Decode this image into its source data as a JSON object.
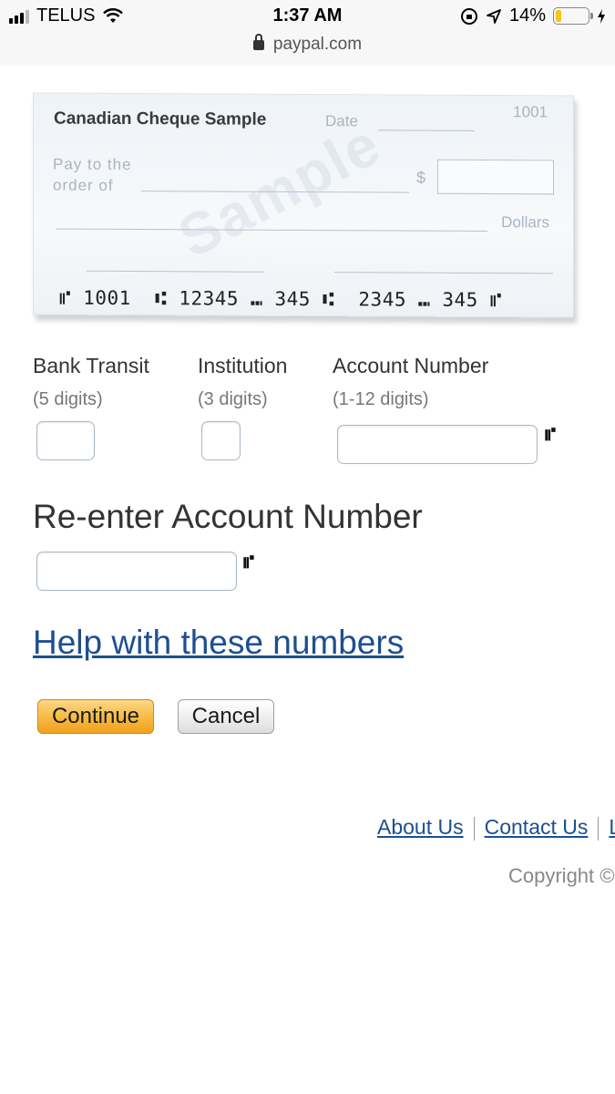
{
  "status_bar": {
    "carrier": "TELUS",
    "time": "1:37 AM",
    "battery": "14%",
    "battery_level": 0.14
  },
  "browser": {
    "url": "paypal.com"
  },
  "cheque": {
    "title": "Canadian Cheque Sample",
    "date_label": "Date",
    "cheque_number": "1001",
    "pay_to_line1": "Pay to the",
    "pay_to_line2": "order of",
    "dollar_sign": "$",
    "dollars_label": "Dollars",
    "watermark": "Sample",
    "micr_line": "⑈ 1001  ⑆ 12345 ⑉ 345 ⑆  2345 ⑉ 345 ⑈"
  },
  "form": {
    "bank_transit": {
      "label": "Bank Transit",
      "hint": "(5 digits)",
      "value": ""
    },
    "institution": {
      "label": "Institution",
      "hint": "(3 digits)",
      "value": ""
    },
    "account_number": {
      "label": "Account Number",
      "hint": "(1-12 digits)",
      "value": ""
    },
    "reenter_account": {
      "label": "Re-enter Account Number",
      "value": ""
    },
    "micr_symbol": "⑈",
    "help_link": "Help with these numbers",
    "continue_label": "Continue",
    "cancel_label": "Cancel"
  },
  "footer": {
    "links": [
      "About Us",
      "Contact Us",
      "L"
    ],
    "copyright": "Copyright ©"
  },
  "colors": {
    "link": "#1c4f91",
    "continue_button": "#f7b940"
  }
}
